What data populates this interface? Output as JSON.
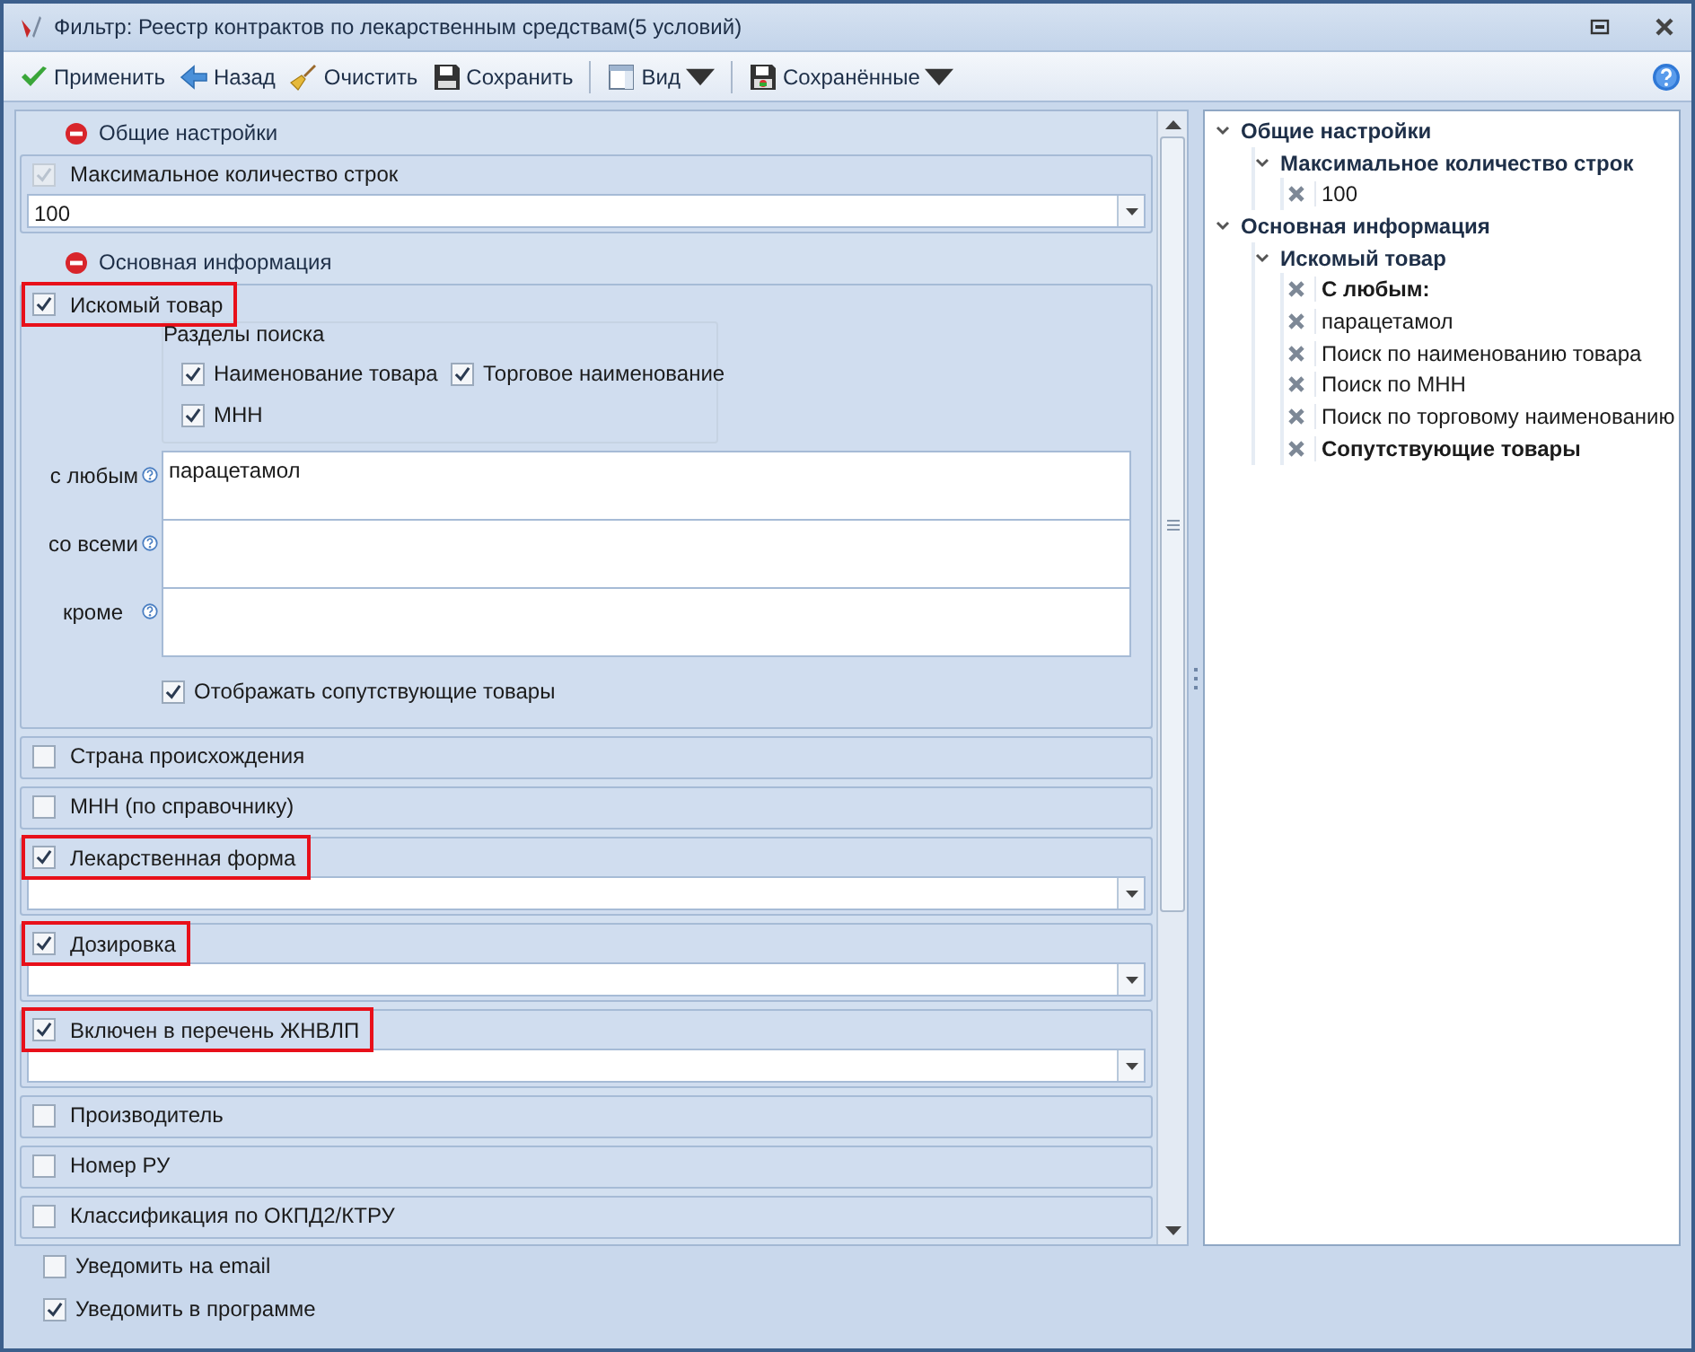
{
  "window": {
    "title": "Фильтр: Реестр контрактов по лекарственным средствам(5 условий)"
  },
  "toolbar": {
    "groups": [
      [
        {
          "kind": "apply",
          "label": "Применить",
          "dropdown": false
        },
        {
          "kind": "back",
          "label": "Назад",
          "dropdown": false
        },
        {
          "kind": "clear",
          "label": "Очистить",
          "dropdown": false
        },
        {
          "kind": "save",
          "label": "Сохранить",
          "dropdown": false
        }
      ],
      [
        {
          "kind": "view",
          "label": "Вид",
          "dropdown": true
        }
      ],
      [
        {
          "kind": "saved",
          "label": "Сохранённые",
          "dropdown": true
        }
      ]
    ]
  },
  "filter_groups": [
    {
      "title": "Общие настройки",
      "sections": [
        {
          "kind": "combo",
          "label": "Максимальное количество строк",
          "checked": true,
          "disabled": true,
          "highlighted": false,
          "value": "100"
        }
      ]
    },
    {
      "title": "Основная информация",
      "sections": [
        {
          "kind": "search",
          "label": "Искомый товар",
          "checked": true,
          "disabled": false,
          "highlighted": true,
          "search_sections": {
            "title": "Разделы поиска",
            "options": [
              {
                "label": "Наименование товара",
                "checked": true
              },
              {
                "label": "Торговое наименование",
                "checked": true
              },
              {
                "label": "МНН",
                "checked": true
              }
            ]
          },
          "fields": [
            {
              "label": "с любым",
              "value": "парацетамол"
            },
            {
              "label": "со всеми"
            },
            {
              "label": "кроме"
            }
          ],
          "related": {
            "label": "Отображать сопутствующие товары",
            "checked": true
          }
        },
        {
          "kind": "plain",
          "label": "Страна происхождения",
          "checked": false,
          "disabled": false,
          "highlighted": false
        },
        {
          "kind": "plain",
          "label": "МНН (по справочнику)",
          "checked": false,
          "disabled": false,
          "highlighted": false
        },
        {
          "kind": "combo",
          "label": "Лекарственная форма",
          "checked": true,
          "disabled": false,
          "highlighted": true
        },
        {
          "kind": "combo",
          "label": "Дозировка",
          "checked": true,
          "disabled": false,
          "highlighted": true
        },
        {
          "kind": "combo",
          "label": "Включен в перечень ЖНВЛП",
          "checked": true,
          "disabled": false,
          "highlighted": true
        },
        {
          "kind": "plain",
          "label": "Производитель",
          "checked": false,
          "disabled": false,
          "highlighted": false
        },
        {
          "kind": "plain",
          "label": "Номер РУ",
          "checked": false,
          "disabled": false,
          "highlighted": false
        },
        {
          "kind": "plain",
          "label": "Классификация по ОКПД2/КТРУ",
          "checked": false,
          "disabled": false,
          "highlighted": false
        }
      ]
    }
  ],
  "notifications": [
    {
      "label": "Уведомить на email",
      "checked": false
    },
    {
      "label": "Уведомить в программе",
      "checked": true
    }
  ],
  "summary": [
    {
      "label": "Общие настройки",
      "expanded": true,
      "children": [
        {
          "label": "Максимальное количество строк",
          "expanded": true,
          "children": [
            {
              "label": "100",
              "bold": false
            }
          ]
        }
      ]
    },
    {
      "label": "Основная информация",
      "expanded": true,
      "children": [
        {
          "label": "Искомый товар",
          "expanded": true,
          "children": [
            {
              "label": "С любым:",
              "bold": true
            },
            {
              "label": "парацетамол",
              "bold": false
            },
            {
              "label": "Поиск по наименованию товара",
              "bold": false
            },
            {
              "label": "Поиск по МНН",
              "bold": false
            },
            {
              "label": "Поиск по торговому наименованию",
              "bold": false
            },
            {
              "label": "Сопутствующие товары",
              "bold": true
            }
          ]
        }
      ]
    }
  ]
}
